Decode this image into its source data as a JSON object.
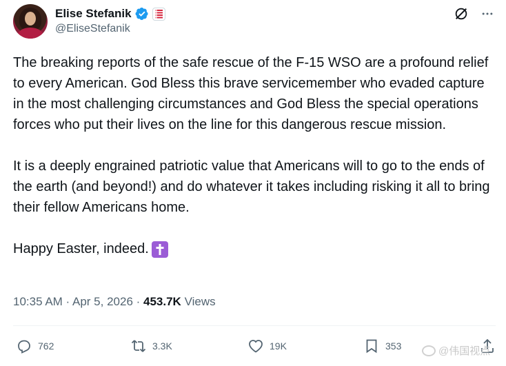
{
  "author": {
    "display_name": "Elise Stefanik",
    "handle": "@EliseStefanik"
  },
  "tweet": {
    "paragraphs": [
      "The breaking reports of the safe rescue of the F-15 WSO are a profound relief to every American. God Bless this brave servicemember who evaded capture in the most challenging circumstances and God Bless the special operations forces who put their lives on the line for this dangerous rescue mission.",
      "It is a deeply engrained patriotic value that Americans will to go to the ends of the earth (and beyond!) and do whatever it takes including risking it all to bring their fellow Americans home.",
      "Happy Easter, indeed."
    ],
    "emoji": "latin-cross-emoji"
  },
  "meta": {
    "time": "10:35 AM",
    "separator": " · ",
    "date": "Apr 5, 2026",
    "views_count": "453.7K",
    "views_label": "Views"
  },
  "actions": {
    "replies": "762",
    "reposts": "3.3K",
    "likes": "19K",
    "bookmarks": "353"
  },
  "watermark": {
    "text": "@伟国视点"
  },
  "colors": {
    "text": "#0f1419",
    "secondary": "#536471",
    "verified": "#1d9bf0",
    "emoji_bg": "#9b5cd6"
  }
}
